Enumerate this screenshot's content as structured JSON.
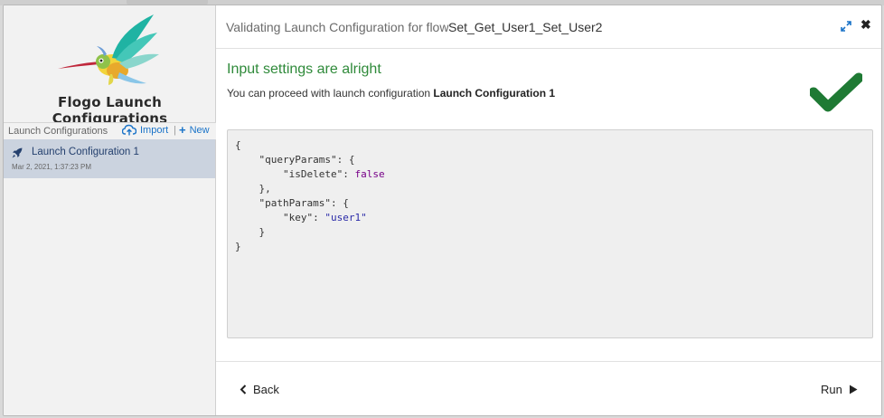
{
  "sidebar": {
    "app_title": "Flogo Launch Configurations",
    "list_title": "Launch Configurations",
    "import_label": "Import",
    "separator": "|",
    "new_label": "New",
    "items": [
      {
        "name": "Launch Configuration 1",
        "date": "Mar 2, 2021, 1:37:23 PM"
      }
    ]
  },
  "header": {
    "label": "Validating Launch Configuration for flow",
    "flow_name": "Set_Get_User1_Set_User2"
  },
  "status": {
    "title": "Input settings are alright",
    "message_prefix": "You can proceed with launch configuration",
    "config_name": "Launch Configuration 1"
  },
  "code": {
    "open": "{",
    "query_key": "\"queryParams\": {",
    "is_delete_key": "\"isDelete\": ",
    "is_delete_val": "false",
    "query_close": "},",
    "path_key": "\"pathParams\": {",
    "key_key": "\"key\": ",
    "key_val": "\"user1\"",
    "path_close": "}",
    "close": "}"
  },
  "footer": {
    "back_label": "Back",
    "run_label": "Run"
  },
  "colors": {
    "accent": "#1a73c8",
    "success": "#2f8a3a",
    "selected_row": "#cbd3df"
  },
  "icons": [
    "hummingbird-logo",
    "cloud-upload-icon",
    "plus-icon",
    "rocket-icon",
    "expand-icon",
    "close-icon",
    "checkmark-icon",
    "chevron-left-icon",
    "play-icon"
  ]
}
